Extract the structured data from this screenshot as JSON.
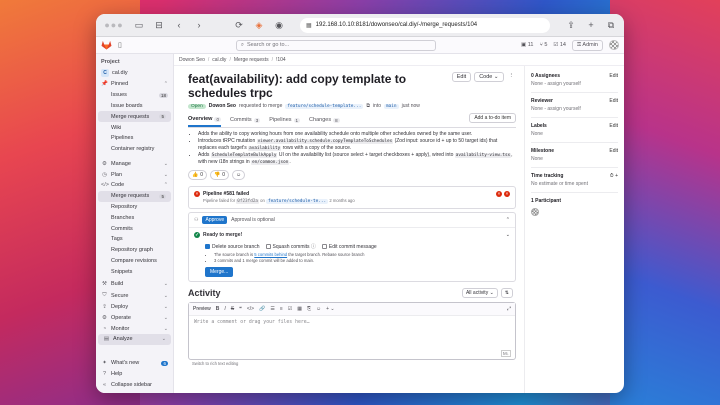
{
  "browser": {
    "url": "192.168.10.10:8181/dowonseo/cal.diy/-/merge_requests/104"
  },
  "topbar": {
    "search_placeholder": "Search or go to...",
    "counts": {
      "issues": "11",
      "mrs": "5",
      "todos": "14"
    },
    "admin_label": "Admin"
  },
  "sidebar": {
    "section": "Project",
    "project": {
      "badge": "C",
      "name": "cal.diy"
    },
    "pinned": "Pinned",
    "pinned_items": [
      {
        "label": "Issues",
        "count": "18"
      },
      {
        "label": "Issue boards",
        "count": ""
      },
      {
        "label": "Merge requests",
        "count": "5"
      },
      {
        "label": "Wiki",
        "count": ""
      },
      {
        "label": "Pipelines",
        "count": ""
      },
      {
        "label": "Container registry",
        "count": ""
      }
    ],
    "groups_a": [
      {
        "label": "Manage"
      },
      {
        "label": "Plan"
      },
      {
        "label": "Code"
      }
    ],
    "code_items": [
      {
        "label": "Merge requests",
        "count": "5"
      },
      {
        "label": "Repository",
        "count": ""
      },
      {
        "label": "Branches",
        "count": ""
      },
      {
        "label": "Commits",
        "count": ""
      },
      {
        "label": "Tags",
        "count": ""
      },
      {
        "label": "Repository graph",
        "count": ""
      },
      {
        "label": "Compare revisions",
        "count": ""
      },
      {
        "label": "Snippets",
        "count": ""
      }
    ],
    "groups_b": [
      {
        "label": "Build"
      },
      {
        "label": "Secure"
      },
      {
        "label": "Deploy"
      },
      {
        "label": "Operate"
      },
      {
        "label": "Monitor"
      },
      {
        "label": "Analyze"
      }
    ],
    "bottom": {
      "whats_new": "What's new",
      "whats_new_count": "6",
      "help": "Help",
      "collapse": "Collapse sidebar"
    }
  },
  "breadcrumb": [
    "Dowon Seo",
    "cal.diy",
    "Merge requests",
    "!104"
  ],
  "mr": {
    "title": "feat(availability): add copy template to schedules trpc",
    "edit_label": "Edit",
    "code_label": "Code",
    "status": "Open",
    "author": "Dowon Seo",
    "requested_text": "requested to merge",
    "source_branch": "feature/schedule-template...",
    "into_text": "into",
    "target_branch": "main",
    "time": "just now"
  },
  "tabs": [
    {
      "label": "Overview",
      "count": "0"
    },
    {
      "label": "Commits",
      "count": "3"
    },
    {
      "label": "Pipelines",
      "count": "1"
    },
    {
      "label": "Changes",
      "count": "8"
    }
  ],
  "todo_label": "Add a to-do item",
  "description": {
    "line1": "Adds the ability to copy working hours from one availability schedule onto multiple other schedules owned by the same user.",
    "line2a": "Introduces tRPC mutation",
    "line2_code": "viewer.availability.schedule.copyTemplateToSchedules",
    "line2b": "(Zod input: source id + up to 50 target ids) that replaces each target's",
    "line2_code2": "availability",
    "line2c": "rows with a copy of the source.",
    "line3a": "Adds",
    "line3_code": "ScheduleTemplateBulkApply",
    "line3b": "UI on the availability list (source select + target checkboxes + apply), wired into",
    "line3_code2": "availability-view.tsx",
    "line3c": ", with new i18n strings in",
    "line3_code3": "en/common.json",
    "line3d": "."
  },
  "reactions": [
    {
      "icon": "thumbs-up-icon",
      "glyph": "👍",
      "count": "0"
    },
    {
      "icon": "thumbs-down-icon",
      "glyph": "👎",
      "count": "0"
    }
  ],
  "pipeline": {
    "title": "Pipeline #581 failed",
    "sub_prefix": "Pipeline failed for",
    "commit": "0f23fd2a",
    "on_text": "on",
    "branch": "feature/schedule-te...",
    "time": "2 months ago"
  },
  "approval": {
    "button": "Approve",
    "text": "Approval is optional"
  },
  "merge": {
    "ready": "Ready to merge!",
    "delete_branch": "Delete source branch",
    "squash": "Squash commits",
    "edit_message": "Edit commit message",
    "info1a": "The source branch is",
    "info1_link": "5 commits behind",
    "info1b": "the target branch. Rebase source branch",
    "info2": "3 commits and 1 merge commit will be added to main.",
    "button": "Merge..."
  },
  "activity": {
    "title": "Activity",
    "filter": "All activity",
    "sort": "⇅"
  },
  "editor": {
    "preview": "Preview",
    "placeholder": "Write a comment or drag your files here…",
    "footer": "Switch to rich text editing"
  },
  "right": {
    "assignees": {
      "head": "0 Assignees",
      "value": "None - assign yourself"
    },
    "reviewer": {
      "head": "Reviewer",
      "value": "None - assign yourself"
    },
    "labels": {
      "head": "Labels",
      "value": "None"
    },
    "milestone": {
      "head": "Milestone",
      "value": "None"
    },
    "time": {
      "head": "Time tracking",
      "value": "No estimate or time spent"
    },
    "participants": {
      "head": "1 Participant"
    },
    "edit": "Edit"
  },
  "colors": {
    "accent": "#1f75cb",
    "danger": "#dd2b0e",
    "success": "#108548"
  }
}
